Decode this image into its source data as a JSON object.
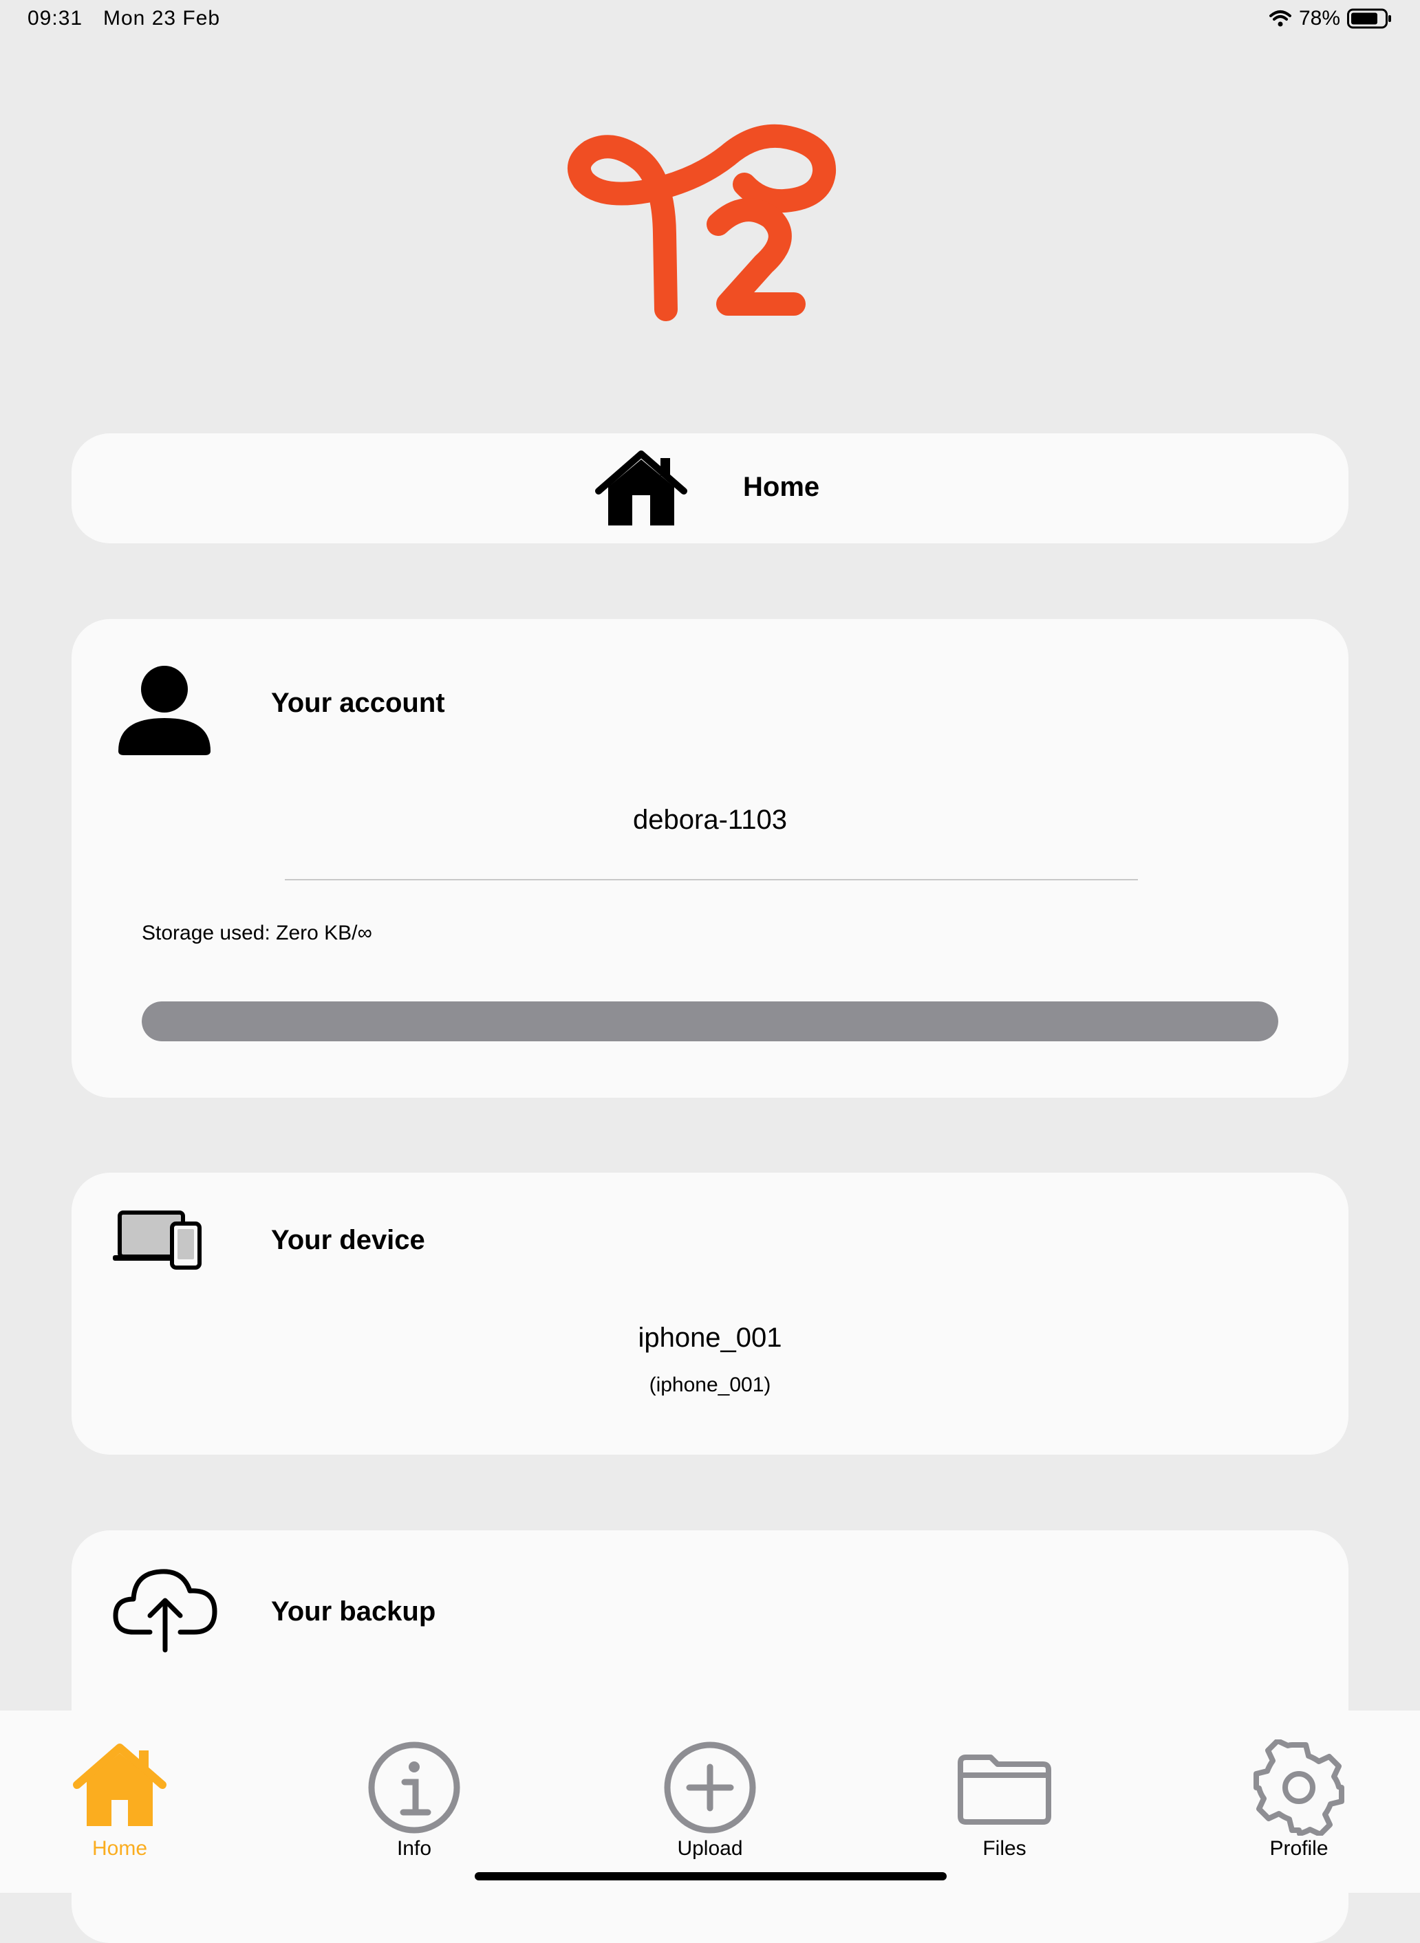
{
  "status_bar": {
    "time": "09:31",
    "date": "Mon 23 Feb",
    "battery": "78%",
    "icons": [
      "wifi-icon",
      "battery-icon"
    ]
  },
  "colors": {
    "brand": "#f04e23",
    "tab_active": "#fbad1f",
    "tab_inactive": "#8e8e93",
    "progress": "#8e8e93"
  },
  "header": {
    "title": "Home",
    "icon": "home-icon"
  },
  "account": {
    "title": "Your account",
    "icon": "person-icon",
    "username": "debora-1103",
    "storage_text": "Storage used: Zero KB/∞",
    "storage_fraction": 1.0
  },
  "device": {
    "title": "Your device",
    "icon": "devices-icon",
    "name": "iphone_001",
    "id": "(iphone_001)"
  },
  "backup": {
    "title": "Your backup",
    "icon": "cloud-upload-icon"
  },
  "tabs": [
    {
      "label": "Home",
      "icon": "home-icon",
      "active": true
    },
    {
      "label": "Info",
      "icon": "info-icon",
      "active": false
    },
    {
      "label": "Upload",
      "icon": "plus-circle-icon",
      "active": false
    },
    {
      "label": "Files",
      "icon": "folder-icon",
      "active": false
    },
    {
      "label": "Profile",
      "icon": "gear-icon",
      "active": false
    }
  ]
}
